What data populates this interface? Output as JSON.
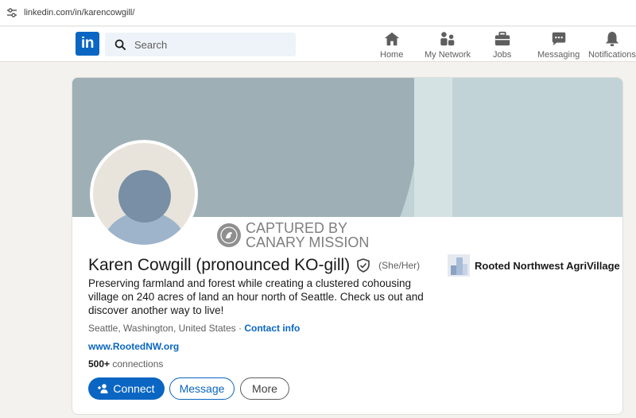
{
  "browser": {
    "url": "linkedin.com/in/karencowgill/"
  },
  "nav": {
    "logo_text": "in",
    "search_placeholder": "Search",
    "items": [
      {
        "label": "Home",
        "icon": "home-icon"
      },
      {
        "label": "My Network",
        "icon": "network-icon"
      },
      {
        "label": "Jobs",
        "icon": "briefcase-icon"
      },
      {
        "label": "Messaging",
        "icon": "chat-icon"
      },
      {
        "label": "Notifications",
        "icon": "bell-icon"
      }
    ]
  },
  "profile": {
    "name": "Karen Cowgill (pronounced KO-gill)",
    "pronouns": "(She/Her)",
    "headline": "Preserving farmland and forest while creating a clustered cohousing village on 240 acres of land an hour north of Seattle. Check us out and discover another way to live!",
    "location": "Seattle, Washington, United States",
    "separator": " · ",
    "contact_info": "Contact info",
    "website": "www.RootedNW.org",
    "connections_count": "500+",
    "connections_label": " connections",
    "company": "Rooted Northwest AgriVillage"
  },
  "watermark": {
    "line1": "CAPTURED BY",
    "line2": "CANARY MISSION"
  },
  "actions": {
    "connect": "Connect",
    "message": "Message",
    "more": "More"
  },
  "colors": {
    "brand": "#0a66c2",
    "banner": "#c1d3d6",
    "banner_circle": "#9eb0b5"
  }
}
